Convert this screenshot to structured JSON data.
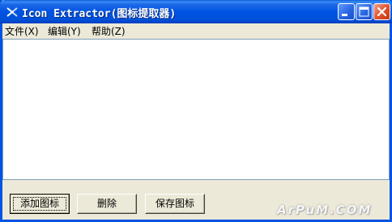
{
  "window": {
    "title": "Icon Extractor(图标提取器)",
    "title_color": "#0054e3"
  },
  "menu": {
    "file": "文件(X)",
    "edit": "编辑(Y)",
    "help": "帮助(Z)"
  },
  "buttons": {
    "add": "添加图标",
    "delete": "删除",
    "save": "保存图标"
  },
  "watermark": "ArPuM.COM",
  "icons": {
    "app": "extractor-app-icon",
    "minimize": "minimize-icon",
    "maximize": "maximize-icon",
    "close": "close-icon"
  }
}
